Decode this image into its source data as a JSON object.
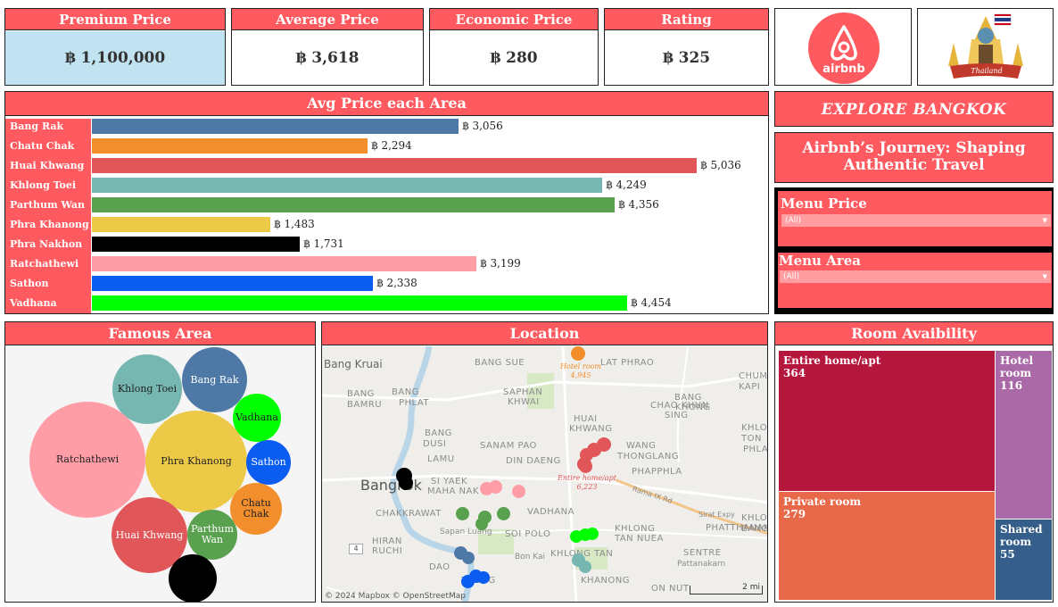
{
  "kpis": [
    {
      "label": "Premium Price",
      "value": "฿ 1,100,000"
    },
    {
      "label": "Average Price",
      "value": "฿ 3,618"
    },
    {
      "label": "Economic Price",
      "value": "฿ 280"
    },
    {
      "label": "Rating",
      "value": "฿ 325"
    }
  ],
  "logos": {
    "airbnb_text": "airbnb",
    "thailand_text": "Thailand"
  },
  "area_chart": {
    "title": "Avg Price each Area"
  },
  "chart_data": {
    "type": "bar",
    "orientation": "horizontal",
    "categories": [
      "Bang Rak",
      "Chatu Chak",
      "Huai Khwang",
      "Khlong Toei",
      "Parthum Wan",
      "Phra Khanong",
      "Phra Nakhon",
      "Ratchathewi",
      "Sathon",
      "Vadhana"
    ],
    "values": [
      3056,
      2294,
      5036,
      4249,
      4356,
      1483,
      1731,
      3199,
      2338,
      4454
    ],
    "value_labels": [
      "฿ 3,056",
      "฿ 2,294",
      "฿ 5,036",
      "฿ 4,249",
      "฿ 4,356",
      "฿ 1,483",
      "฿ 1,731",
      "฿ 3,199",
      "฿ 2,338",
      "฿ 4,454"
    ],
    "colors": [
      "#4e79a7",
      "#f28e2b",
      "#e15759",
      "#76b7b2",
      "#59a14f",
      "#edc948",
      "#000000",
      "#ff9da7",
      "#0b5cf0",
      "#00ff00"
    ],
    "xlim": [
      0,
      5036
    ],
    "title": "Avg Price each Area",
    "xlabel": "",
    "ylabel": "",
    "grid": false
  },
  "explore": {
    "title": "EXPLORE BANGKOK",
    "tagline": "Airbnb’s Journey: Shaping Authentic Travel"
  },
  "filters": [
    {
      "label": "Menu Price",
      "selected": "(All)"
    },
    {
      "label": "Menu Area",
      "selected": "(All)"
    }
  ],
  "famous": {
    "title": "Famous Area",
    "bubbles": [
      {
        "label": "Khlong Toei",
        "color": "#76b7b2"
      },
      {
        "label": "Bang Rak",
        "color": "#4e79a7"
      },
      {
        "label": "Vadhana",
        "color": "#00ff00"
      },
      {
        "label": "Ratchathewi",
        "color": "#ff9da7"
      },
      {
        "label": "Phra Khanong",
        "color": "#edc948"
      },
      {
        "label": "Sathon",
        "color": "#0b5cf0"
      },
      {
        "label": "Chatu Chak",
        "color": "#f28e2b"
      },
      {
        "label": "Huai Khwang",
        "color": "#e15759"
      },
      {
        "label": "Parthum Wan",
        "color": "#59a14f"
      },
      {
        "label": "",
        "color": "#000000"
      }
    ]
  },
  "location": {
    "title": "Location",
    "places": [
      "Bang Kruai",
      "BANG SUE",
      "LAT PHRAO",
      "CHUM",
      "SAPHAN",
      "KHWAI",
      "BANG",
      "KAPI",
      "BANG",
      "PHLAT",
      "HUAI",
      "KHWANG",
      "BANG",
      "KHONG",
      "CHAO KHUN",
      "SING",
      "DUSI",
      "SANAM PAO",
      "BAMRU",
      "WANG",
      "KHLO",
      "BANG",
      "THONGLANG",
      "TON",
      "LAMU",
      "PHLA",
      "DIN DAENG",
      "PHAPPHLA",
      "Bangkok",
      "SI YAEK",
      "MAHA NAK",
      "Rama IX Rd",
      "CHAKKRAWAT",
      "VADHANA",
      "Sirat Expy",
      "KHLO",
      "BANG",
      "Sapan Luang",
      "SOI POLO",
      "KHLONG",
      "TAN NUEA",
      "PHATTHANAKA",
      "HIRAN",
      "RUCHI",
      "SENTRE",
      "Bon Kai",
      "KHLONG TAN",
      "Pattanakarn",
      "DAO",
      "THUNG",
      "KHANONG",
      "ON NUT"
    ],
    "annotations": [
      {
        "label": "Hotel room",
        "value": "4,945",
        "color": "#f28e2b"
      },
      {
        "label": "Entire home/apt",
        "value": "6,223",
        "color": "#e15759"
      }
    ],
    "copyright": "© 2024 Mapbox  © OpenStreetMap",
    "scale": "2 mi",
    "road_num": "4"
  },
  "rooms": {
    "title": "Room Avaibility",
    "tiles": [
      {
        "label": "Entire home/apt",
        "value": "364",
        "color": "#b5163c"
      },
      {
        "label": "Hotel room",
        "value": "116",
        "color": "#a96aa7"
      },
      {
        "label": "Private room",
        "value": "279",
        "color": "#e8694a"
      },
      {
        "label": "Shared room",
        "value": "55",
        "color": "#355e8a"
      }
    ]
  }
}
